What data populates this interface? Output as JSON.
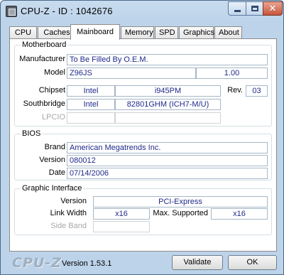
{
  "window": {
    "title": "CPU-Z  -  ID : 1042676"
  },
  "tabs": [
    {
      "label": "CPU"
    },
    {
      "label": "Caches"
    },
    {
      "label": "Mainboard"
    },
    {
      "label": "Memory"
    },
    {
      "label": "SPD"
    },
    {
      "label": "Graphics"
    },
    {
      "label": "About"
    }
  ],
  "active_tab": "Mainboard",
  "motherboard": {
    "legend": "Motherboard",
    "manufacturer_label": "Manufacturer",
    "manufacturer": "To Be Filled By O.E.M.",
    "model_label": "Model",
    "model": "Z96JS",
    "model_revision": "1.00",
    "chipset_label": "Chipset",
    "chipset_vendor": "Intel",
    "chipset_name": "i945PM",
    "rev_label": "Rev.",
    "rev": "03",
    "southbridge_label": "Southbridge",
    "southbridge_vendor": "Intel",
    "southbridge_name": "82801GHM (ICH7-M/U)",
    "lpcio_label": "LPCIO",
    "lpcio_vendor": "",
    "lpcio_name": ""
  },
  "bios": {
    "legend": "BIOS",
    "brand_label": "Brand",
    "brand": "American Megatrends Inc.",
    "version_label": "Version",
    "version": "080012",
    "date_label": "Date",
    "date": "07/14/2006"
  },
  "graphic_interface": {
    "legend": "Graphic Interface",
    "version_label": "Version",
    "version": "PCI-Express",
    "link_width_label": "Link Width",
    "link_width": "x16",
    "max_supported_label": "Max. Supported",
    "max_supported": "x16",
    "side_band_label": "Side Band",
    "side_band": ""
  },
  "footer": {
    "brand": "CPU-Z",
    "version": "Version 1.53.1",
    "validate_label": "Validate",
    "ok_label": "OK"
  },
  "colors": {
    "value_text": "#1f2a8a",
    "frame": "#bcd3ea",
    "close_button": "#c7543c"
  },
  "icons": {
    "app": "cpu-z-chip-icon",
    "minimize": "minimize-icon",
    "maximize": "maximize-icon",
    "close": "close-icon"
  }
}
